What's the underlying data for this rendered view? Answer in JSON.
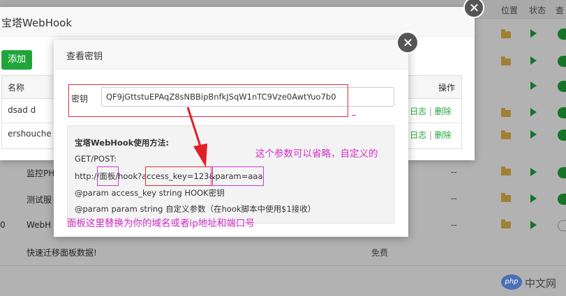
{
  "background_list": {
    "headers": {
      "position": "位置",
      "status": "状态",
      "extra": "查"
    },
    "rows": [
      {
        "name": "监控PH",
        "dash": "--"
      },
      {
        "name": "测试服",
        "dash": "--"
      },
      {
        "name": "WebH",
        "dash": "--",
        "left_mark": "0"
      },
      {
        "name": "快速迁移面板数据!",
        "free": "免费"
      }
    ]
  },
  "webhook_dialog": {
    "title": "宝塔WebHook",
    "add_button": "添加",
    "table": {
      "headers": {
        "name": "名称",
        "actions": "操作"
      },
      "rows": [
        {
          "name": "dsad d",
          "log": "日志",
          "sep": "|",
          "delete": "删除"
        },
        {
          "name": "ershouche",
          "log": "日志",
          "sep": "|",
          "delete": "删除"
        }
      ]
    }
  },
  "key_dialog": {
    "title": "查看密钥",
    "key_label": "密钥",
    "key_value": "QF9jGttstuEPAqZ8sNBBipBnfkJSqW1nTC9Vze0AwtYuo7b0",
    "usage": {
      "title": "宝塔WebHook使用方法:",
      "method": "GET/POST:",
      "url_prefix": "http://",
      "url_panel": "面板",
      "url_path": "/hook?",
      "url_key": "access_key=123",
      "url_param": "&param=aaa",
      "doc_key": "@param access_key string HOOK密钥",
      "doc_param": "@param param string 自定义参数（在hook脚本中使用$1接收）"
    }
  },
  "annotations": {
    "param_note": "这个参数可以省略，自定义的",
    "panel_note": "面板这里替换为你的域名或者ip地址和端口号"
  },
  "watermark": {
    "logo": "php",
    "text": "中文网"
  },
  "colors": {
    "green": "#20a53a",
    "annotation": "#d02ec8",
    "red_box": "#d9303b"
  }
}
